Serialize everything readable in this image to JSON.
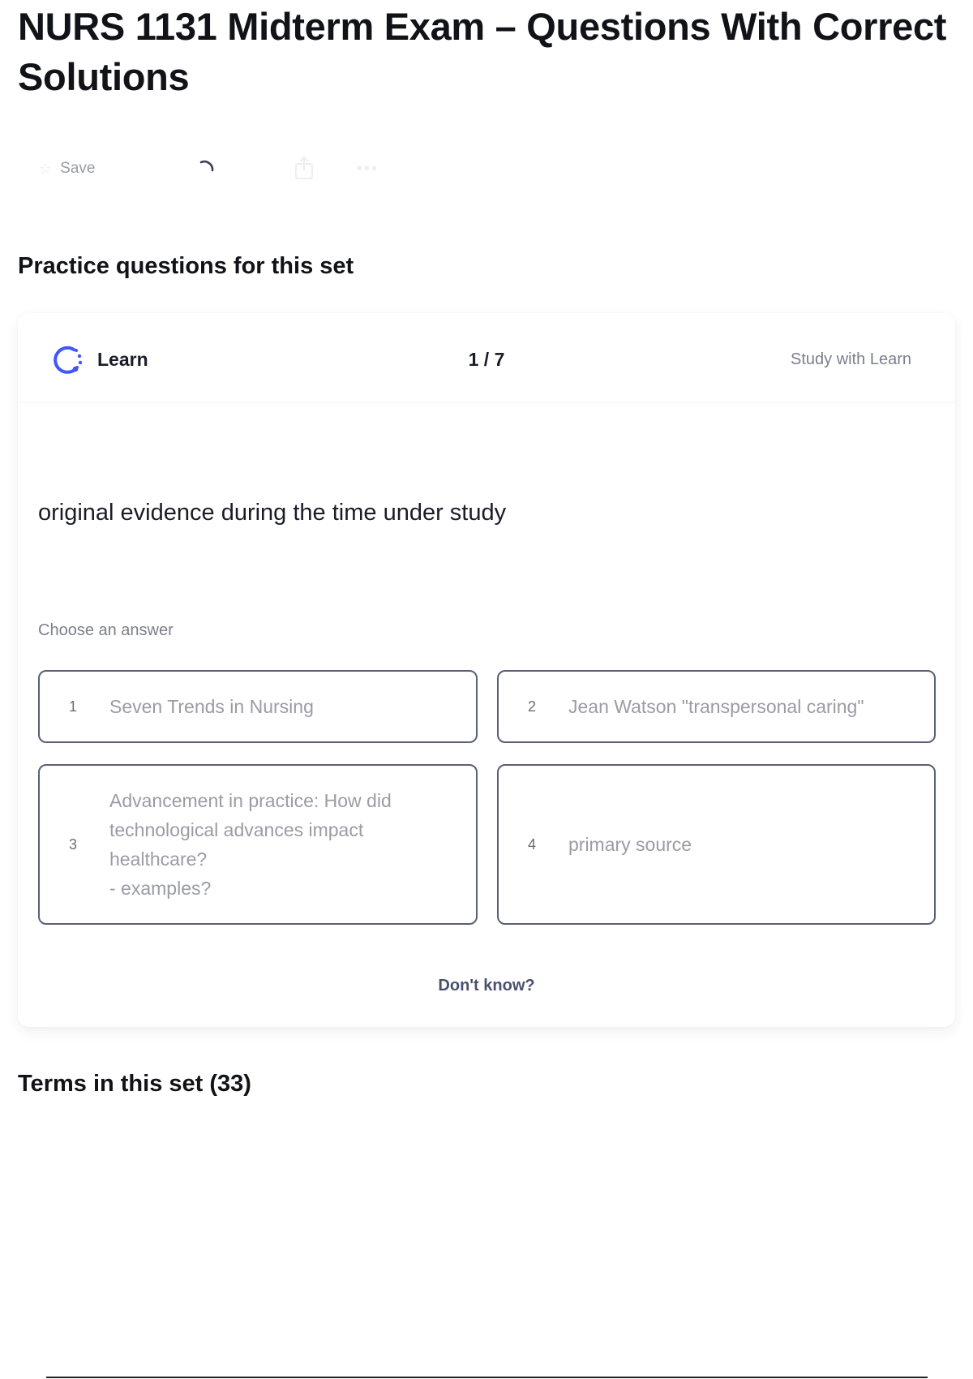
{
  "page": {
    "title": "NURS 1131 Midterm Exam – Questions With Correct Solutions"
  },
  "toolbar": {
    "save_label": "Save",
    "icons": {
      "save": "star-icon",
      "loading": "spinner-icon",
      "share": "share-icon",
      "more": "more-icon"
    }
  },
  "practice": {
    "heading": "Practice questions for this set",
    "card": {
      "mode_label": "Learn",
      "mode_icon": "learn-icon",
      "progress": "1 / 7",
      "study_link": "Study with Learn",
      "question": "original evidence during the time under study",
      "choose_label": "Choose an answer",
      "options": [
        {
          "number": "1",
          "text": "Seven Trends in Nursing"
        },
        {
          "number": "2",
          "text": "Jean Watson \"transpersonal caring\""
        },
        {
          "number": "3",
          "text": "Advancement in practice: How did\ntechnological advances impact\nhealthcare?\n- examples?"
        },
        {
          "number": "4",
          "text": "primary source"
        }
      ],
      "dont_know": "Don't know?"
    }
  },
  "terms": {
    "heading": "Terms in this set (33)"
  },
  "colors": {
    "accent_blue": "#4255ff",
    "option_border": "#5a5f74",
    "muted_text": "#9a9ca6"
  }
}
